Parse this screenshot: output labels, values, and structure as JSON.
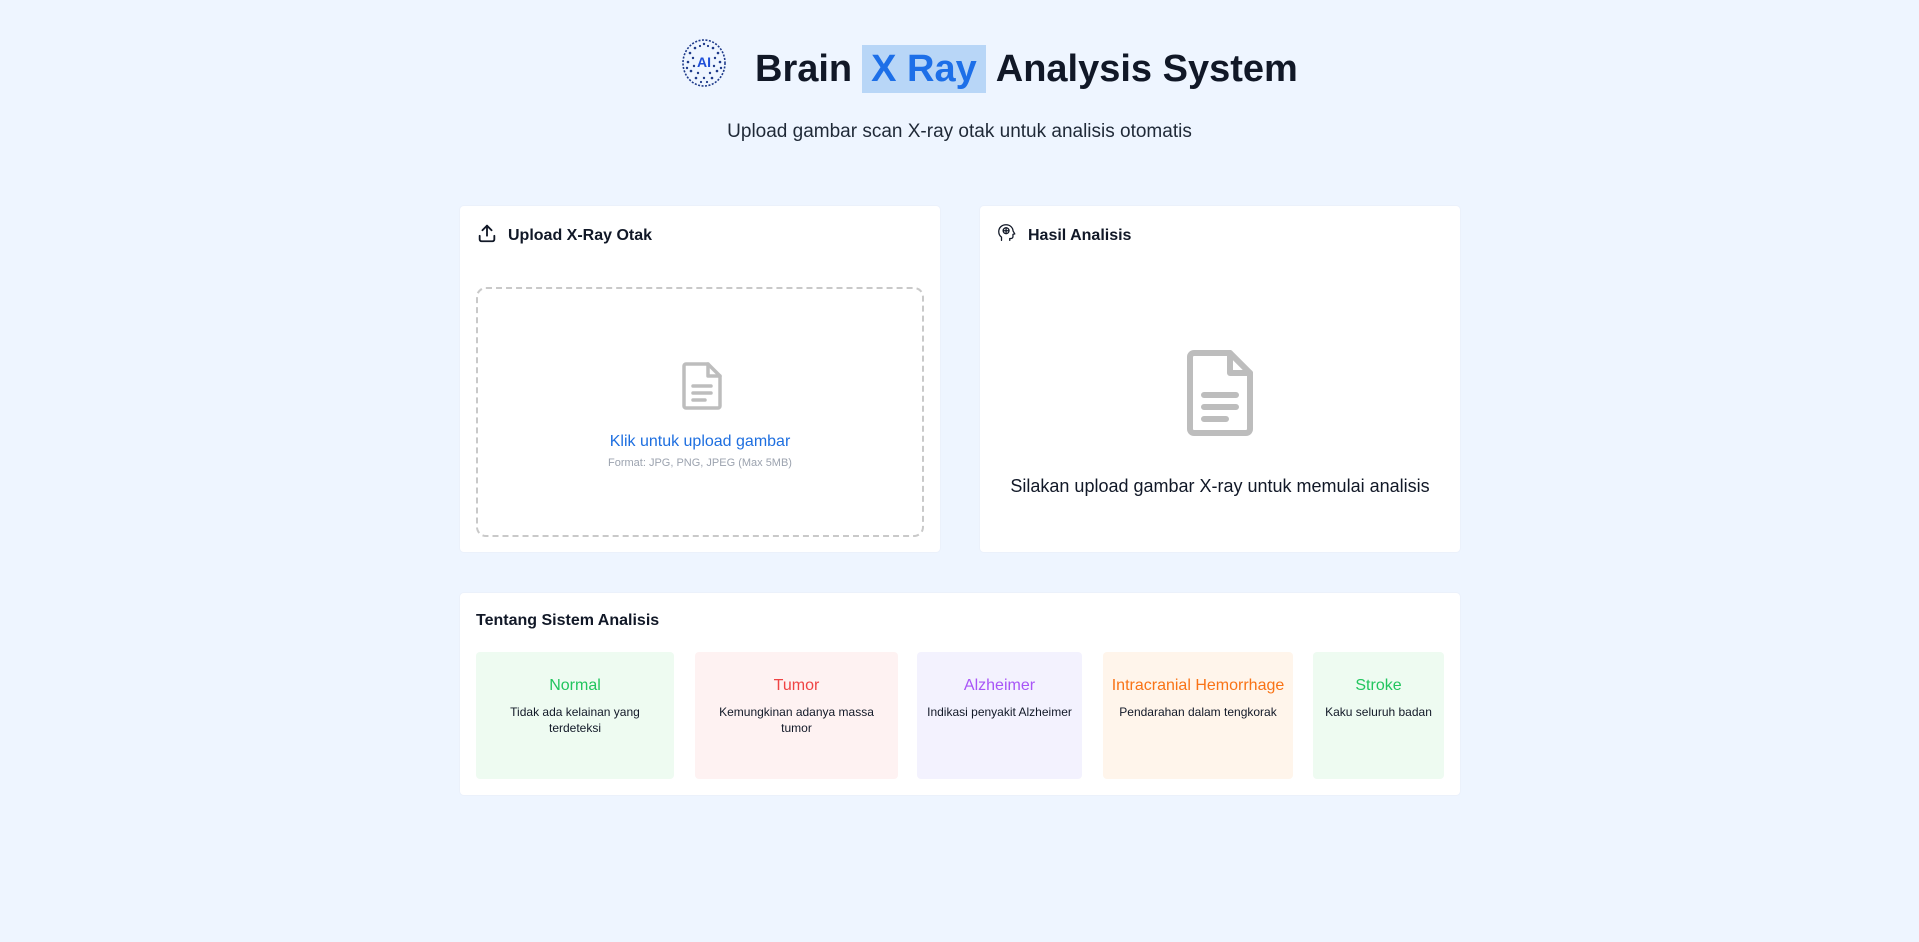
{
  "header": {
    "logo_icon": "ai-brain-icon",
    "logo_text": "AI",
    "title_part1": "Brain",
    "title_highlight": "X Ray",
    "title_part2": "Analysis System",
    "subtitle": "Upload gambar scan X-ray otak untuk analisis otomatis"
  },
  "upload_panel": {
    "icon": "upload-icon",
    "title": "Upload X-Ray Otak",
    "dropzone": {
      "icon": "document-icon",
      "label": "Klik untuk upload gambar",
      "hint": "Format: JPG, PNG, JPEG (Max 5MB)"
    }
  },
  "result_panel": {
    "icon": "brain-head-icon",
    "title": "Hasil Analisis",
    "empty_icon": "document-icon",
    "empty_message": "Silakan upload gambar X-ray untuk memulai analisis"
  },
  "about": {
    "title": "Tentang Sistem Analisis",
    "categories": [
      {
        "name": "Normal",
        "description": "Tidak ada kelainan yang terdeteksi",
        "color": "#22c55e",
        "background": "#eefbf1"
      },
      {
        "name": "Tumor",
        "description": "Kemungkinan adanya massa tumor",
        "color": "#ef4444",
        "background": "#fef2f2"
      },
      {
        "name": "Alzheimer",
        "description": "Indikasi penyakit Alzheimer",
        "color": "#a855f7",
        "background": "#f3f2fe"
      },
      {
        "name": "Intracranial Hemorrhage",
        "description": "Pendarahan dalam tengkorak",
        "color": "#f97316",
        "background": "#fff5eb"
      },
      {
        "name": "Stroke",
        "description": "Kaku seluruh badan",
        "color": "#22c55e",
        "background": "#eefbf1"
      }
    ]
  },
  "colors": {
    "page_background": "#eef5ff",
    "accent": "#1d6fe8",
    "title_highlight_background": "#b8d6f7",
    "card_background": "#ffffff"
  }
}
